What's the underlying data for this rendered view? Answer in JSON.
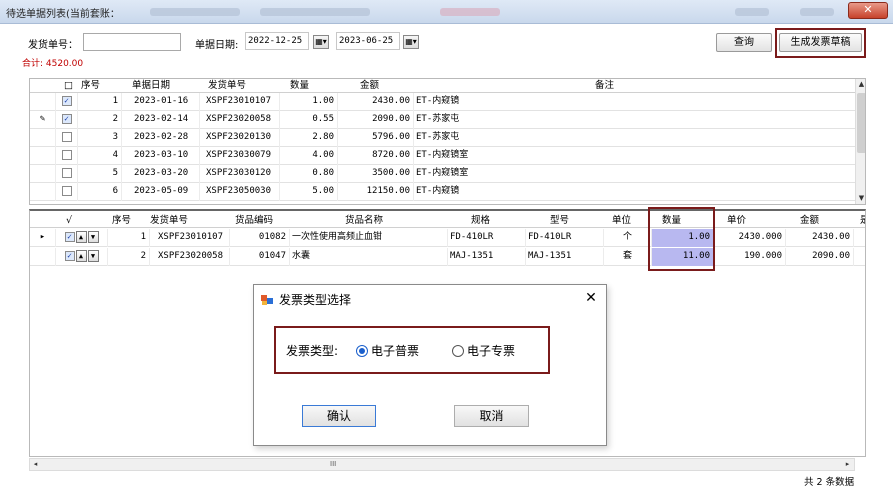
{
  "window": {
    "title": "待选单据列表(当前套账："
  },
  "filter": {
    "doc_no_label": "发货单号：",
    "doc_no_value": "",
    "date_label": "单据日期:",
    "date_from": "2022-12-25",
    "date_to": "2023-06-25",
    "query_label": "查询",
    "generate_label": "生成发票草稿",
    "total_label": "合计: 4520.00"
  },
  "upper_table": {
    "headers": [
      "□",
      "序号",
      "单据日期",
      "发货单号",
      "数量",
      "金额",
      "备注"
    ],
    "rows": [
      {
        "checked": true,
        "pointer": "",
        "no": "1",
        "date": "2023-01-16",
        "doc": "XSPF23010107",
        "qty": "1.00",
        "amount": "2430.00",
        "note": "ET-内窥镜"
      },
      {
        "checked": true,
        "pointer": "✎",
        "no": "2",
        "date": "2023-02-14",
        "doc": "XSPF23020058",
        "qty": "0.55",
        "amount": "2090.00",
        "note": "ET-苏家屯"
      },
      {
        "checked": false,
        "pointer": "",
        "no": "3",
        "date": "2023-02-28",
        "doc": "XSPF23020130",
        "qty": "2.80",
        "amount": "5796.00",
        "note": "ET-苏家屯"
      },
      {
        "checked": false,
        "pointer": "",
        "no": "4",
        "date": "2023-03-10",
        "doc": "XSPF23030079",
        "qty": "4.00",
        "amount": "8720.00",
        "note": "ET-内窥镜室"
      },
      {
        "checked": false,
        "pointer": "",
        "no": "5",
        "date": "2023-03-20",
        "doc": "XSPF23030120",
        "qty": "0.80",
        "amount": "3500.00",
        "note": "ET-内窥镜室"
      },
      {
        "checked": false,
        "pointer": "",
        "no": "6",
        "date": "2023-05-09",
        "doc": "XSPF23050030",
        "qty": "5.00",
        "amount": "12150.00",
        "note": "ET-内窥镜"
      }
    ]
  },
  "lower_table": {
    "headers": [
      "√",
      "序号",
      "发货单号",
      "货品编码",
      "货品名称",
      "规格",
      "型号",
      "单位",
      "数量",
      "单价",
      "金额",
      "是"
    ],
    "rows": [
      {
        "pointer": "▸",
        "no": "1",
        "doc": "XSPF23010107",
        "code": "01082",
        "name": "一次性使用高频止血钳",
        "spec": "FD-410LR",
        "model": "FD-410LR",
        "unit": "个",
        "qty": "1.00",
        "price": "2430.000",
        "amount": "2430.00"
      },
      {
        "pointer": "",
        "no": "2",
        "doc": "XSPF23020058",
        "code": "01047",
        "name": "水囊",
        "spec": "MAJ-1351",
        "model": "MAJ-1351",
        "unit": "套",
        "qty": "11.00",
        "price": "190.000",
        "amount": "2090.00"
      }
    ]
  },
  "dialog": {
    "title": "发票类型选择",
    "type_label": "发票类型:",
    "option1": "电子普票",
    "option2": "电子专票",
    "selected": "电子普票",
    "ok_label": "确认",
    "cancel_label": "取消"
  },
  "status": {
    "count_text": "共 2 条数据"
  },
  "colors": {
    "highlight_border": "#7a1b1b",
    "total_text": "#c00000",
    "selected_qty_bg": "#b8b8f0",
    "radio_accent": "#1a5fcc"
  }
}
